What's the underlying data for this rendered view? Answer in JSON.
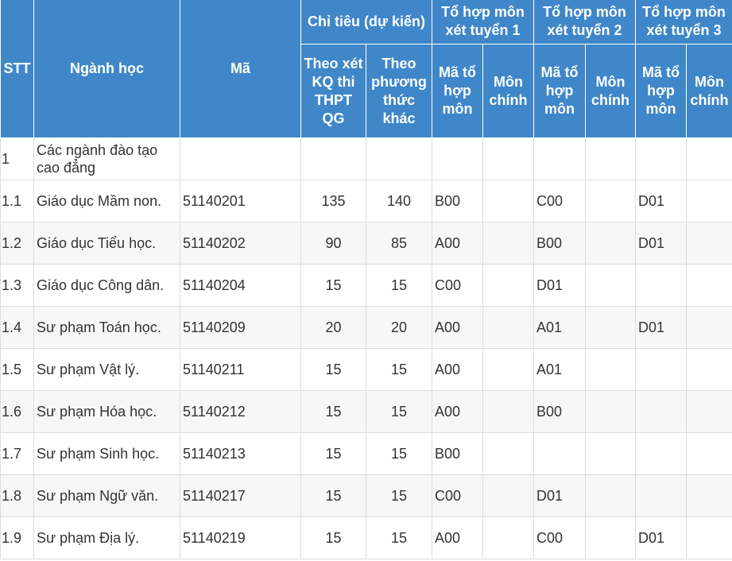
{
  "header": {
    "stt": "STT",
    "nganh": "Ngành học",
    "ma": "Mã",
    "chitieu": "Chỉ tiêu (dự kiến)",
    "to_hop_1": "Tổ hợp môn xét tuyển 1",
    "to_hop_2": "Tổ hợp môn xét tuyển 2",
    "to_hop_3": "Tổ hợp môn xét tuyển 3",
    "theo_thpt": "Theo xét KQ thi THPT QG",
    "theo_khac": "Theo phương thức khác",
    "ma_to_hop": "Mã tổ hợp môn",
    "mon_chinh": "Môn chính"
  },
  "rows": [
    {
      "stt": "1",
      "nganh": "Các ngành đào tạo cao đẳng",
      "ma": "",
      "thpt": "",
      "khac": "",
      "th1": "",
      "mc1": "",
      "th2": "",
      "mc2": "",
      "th3": "",
      "mc3": ""
    },
    {
      "stt": "1.1",
      "nganh": "Giáo dục Mầm non.",
      "ma": "51140201",
      "thpt": "135",
      "khac": "140",
      "th1": "B00",
      "mc1": "",
      "th2": "C00",
      "mc2": "",
      "th3": "D01",
      "mc3": ""
    },
    {
      "stt": "1.2",
      "nganh": "Giáo dục Tiểu học.",
      "ma": "51140202",
      "thpt": "90",
      "khac": "85",
      "th1": "A00",
      "mc1": "",
      "th2": "B00",
      "mc2": "",
      "th3": "D01",
      "mc3": ""
    },
    {
      "stt": "1.3",
      "nganh": "Giáo dục Công dân.",
      "ma": "51140204",
      "thpt": "15",
      "khac": "15",
      "th1": "C00",
      "mc1": "",
      "th2": "D01",
      "mc2": "",
      "th3": "",
      "mc3": ""
    },
    {
      "stt": "1.4",
      "nganh": "Sư phạm Toán học.",
      "ma": "51140209",
      "thpt": "20",
      "khac": "20",
      "th1": "A00",
      "mc1": "",
      "th2": "A01",
      "mc2": "",
      "th3": "D01",
      "mc3": ""
    },
    {
      "stt": "1.5",
      "nganh": "Sư phạm Vật lý.",
      "ma": "51140211",
      "thpt": "15",
      "khac": "15",
      "th1": "A00",
      "mc1": "",
      "th2": "A01",
      "mc2": "",
      "th3": "",
      "mc3": ""
    },
    {
      "stt": "1.6",
      "nganh": "Sư phạm Hóa học.",
      "ma": "51140212",
      "thpt": "15",
      "khac": "15",
      "th1": "A00",
      "mc1": "",
      "th2": "B00",
      "mc2": "",
      "th3": "",
      "mc3": ""
    },
    {
      "stt": "1.7",
      "nganh": "Sư phạm Sinh học.",
      "ma": "51140213",
      "thpt": "15",
      "khac": "15",
      "th1": "B00",
      "mc1": "",
      "th2": "",
      "mc2": "",
      "th3": "",
      "mc3": ""
    },
    {
      "stt": "1.8",
      "nganh": "Sư phạm Ngữ văn.",
      "ma": "51140217",
      "thpt": "15",
      "khac": "15",
      "th1": "C00",
      "mc1": "",
      "th2": "D01",
      "mc2": "",
      "th3": "",
      "mc3": ""
    },
    {
      "stt": "1.9",
      "nganh": "Sư phạm Địa lý.",
      "ma": "51140219",
      "thpt": "15",
      "khac": "15",
      "th1": "A00",
      "mc1": "",
      "th2": "C00",
      "mc2": "",
      "th3": "D01",
      "mc3": ""
    }
  ]
}
